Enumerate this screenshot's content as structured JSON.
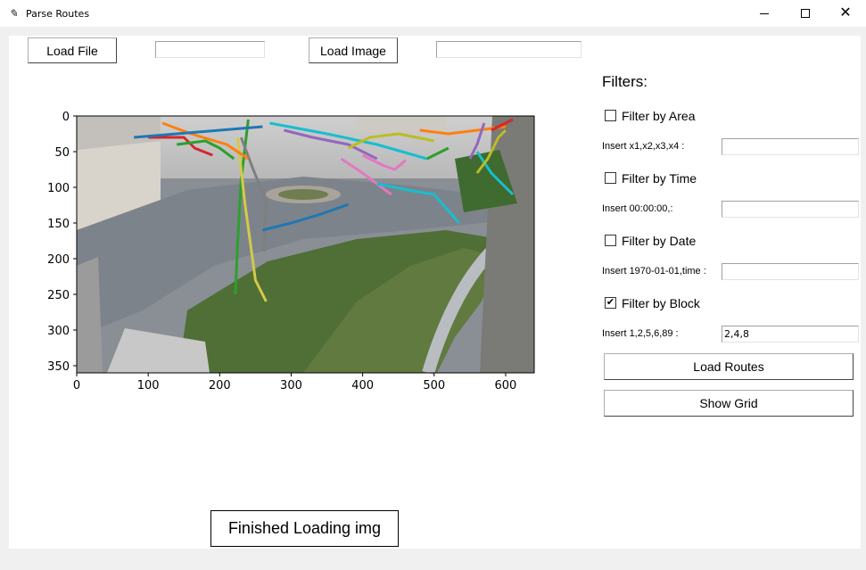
{
  "window": {
    "title": "Parse Routes",
    "minimize_icon": "minimize-icon",
    "maximize_icon": "maximize-icon",
    "close_icon": "close-icon",
    "close_glyph": "✕"
  },
  "toolbar": {
    "load_file_label": "Load File",
    "file_path_value": "",
    "load_image_label": "Load Image",
    "image_path_value": ""
  },
  "filters": {
    "heading": "Filters:",
    "area": {
      "label": "Filter by Area",
      "checked": false,
      "input_label": "Insert x1,x2,x3,x4 :",
      "value": ""
    },
    "time": {
      "label": "Filter by Time",
      "checked": false,
      "input_label": "Insert 00:00:00,:",
      "value": ""
    },
    "date": {
      "label": "Filter by Date",
      "checked": false,
      "input_label": "Insert 1970-01-01,time :",
      "value": ""
    },
    "block": {
      "label": "Filter by Block",
      "checked": true,
      "check_glyph": "✔",
      "input_label": "Insert 1,2,5,6,89 :",
      "value": "2,4,8"
    },
    "load_routes_label": "Load Routes",
    "show_grid_label": "Show Grid"
  },
  "status": {
    "text": "Finished Loading img"
  },
  "chart_data": {
    "type": "line",
    "title": "",
    "xlabel": "",
    "ylabel": "",
    "xlim": [
      0,
      640
    ],
    "ylim": [
      360,
      0
    ],
    "xticks": [
      "0",
      "100",
      "200",
      "300",
      "400",
      "500",
      "600"
    ],
    "yticks": [
      "0",
      "50",
      "100",
      "150",
      "200",
      "250",
      "300",
      "350"
    ],
    "background": "intersection camera photo",
    "series": [
      {
        "color": "#2ca02c",
        "x": [
          240,
          230,
          225,
          222
        ],
        "y": [
          5,
          90,
          180,
          250
        ]
      },
      {
        "color": "#d4c94a",
        "x": [
          225,
          235,
          250,
          265
        ],
        "y": [
          30,
          120,
          230,
          260
        ]
      },
      {
        "color": "#7f7f7f",
        "x": [
          230,
          245,
          265,
          262
        ],
        "y": [
          30,
          70,
          120,
          190
        ]
      },
      {
        "color": "#ff7f0e",
        "x": [
          120,
          160,
          210,
          240
        ],
        "y": [
          10,
          25,
          40,
          60
        ]
      },
      {
        "color": "#d62728",
        "x": [
          100,
          150,
          165,
          190
        ],
        "y": [
          30,
          30,
          45,
          55
        ]
      },
      {
        "color": "#1f77b4",
        "x": [
          80,
          140,
          200,
          260
        ],
        "y": [
          30,
          25,
          20,
          15
        ]
      },
      {
        "color": "#17becf",
        "x": [
          270,
          350,
          420,
          490
        ],
        "y": [
          10,
          25,
          40,
          60
        ]
      },
      {
        "color": "#e377c2",
        "x": [
          370,
          400,
          420,
          440
        ],
        "y": [
          60,
          80,
          95,
          110
        ]
      },
      {
        "color": "#9467bd",
        "x": [
          290,
          330,
          380,
          420
        ],
        "y": [
          20,
          30,
          40,
          60
        ]
      },
      {
        "color": "#bcbd22",
        "x": [
          380,
          410,
          450,
          500
        ],
        "y": [
          45,
          30,
          25,
          35
        ]
      },
      {
        "color": "#17becf",
        "x": [
          420,
          470,
          500,
          535
        ],
        "y": [
          95,
          105,
          110,
          150
        ]
      },
      {
        "color": "#1f77b4",
        "x": [
          260,
          300,
          340,
          380
        ],
        "y": [
          160,
          150,
          138,
          124
        ]
      },
      {
        "color": "#e377c2",
        "x": [
          400,
          430,
          445,
          460
        ],
        "y": [
          55,
          70,
          75,
          62
        ]
      },
      {
        "color": "#ff7f0e",
        "x": [
          480,
          520,
          560,
          600
        ],
        "y": [
          20,
          25,
          20,
          15
        ]
      },
      {
        "color": "#2ca02c",
        "x": [
          490,
          500,
          510,
          520
        ],
        "y": [
          60,
          55,
          50,
          45
        ]
      },
      {
        "color": "#d62728",
        "x": [
          580,
          590,
          600,
          610
        ],
        "y": [
          20,
          15,
          10,
          5
        ]
      },
      {
        "color": "#9467bd",
        "x": [
          550,
          560,
          565,
          570
        ],
        "y": [
          60,
          40,
          25,
          10
        ]
      },
      {
        "color": "#17becf",
        "x": [
          560,
          580,
          600,
          610
        ],
        "y": [
          50,
          80,
          100,
          110
        ]
      },
      {
        "color": "#2ca02c",
        "x": [
          140,
          180,
          200,
          220
        ],
        "y": [
          40,
          35,
          45,
          60
        ]
      },
      {
        "color": "#bcbd22",
        "x": [
          560,
          575,
          590,
          600
        ],
        "y": [
          80,
          60,
          30,
          20
        ]
      }
    ]
  }
}
